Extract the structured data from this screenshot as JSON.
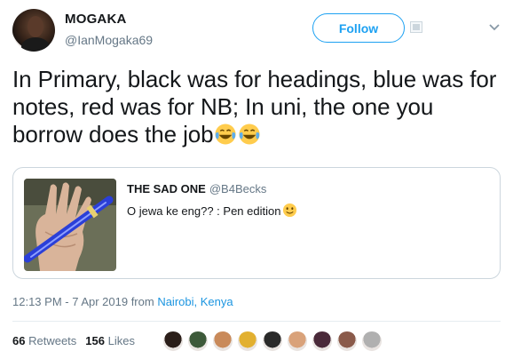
{
  "author": {
    "name": "MOGAKA",
    "handle": "@IanMogaka69"
  },
  "follow_label": "Follow",
  "tweet": {
    "text": "In Primary, black was for headings, blue was for notes, red was for NB; In uni, the one you borrow does the job",
    "emoji": "face-with-tears-of-joy",
    "emoji_count": 2
  },
  "quote": {
    "name": "THE SAD ONE",
    "handle": "@B4Becks",
    "text": "O jewa ke eng?? : Pen edition",
    "emoji": "slightly-smiling-face"
  },
  "meta": {
    "time_date": "12:13 PM - 7 Apr 2019 from ",
    "location": "Nairobi, Kenya"
  },
  "stats": {
    "retweets_count": "66",
    "retweets_label": "Retweets",
    "likes_count": "156",
    "likes_label": "Likes"
  },
  "colors": {
    "accent": "#1da1f2",
    "link": "#1b95e0",
    "muted": "#657786",
    "border": "#ccd6dd"
  },
  "likers": [
    "#2b1f1a",
    "#3d5a3a",
    "#c98a5a",
    "#e2b030",
    "#2a2a2a",
    "#d9a27a",
    "#4a2a3a",
    "#8a5a4a",
    "#b0b0b0"
  ]
}
